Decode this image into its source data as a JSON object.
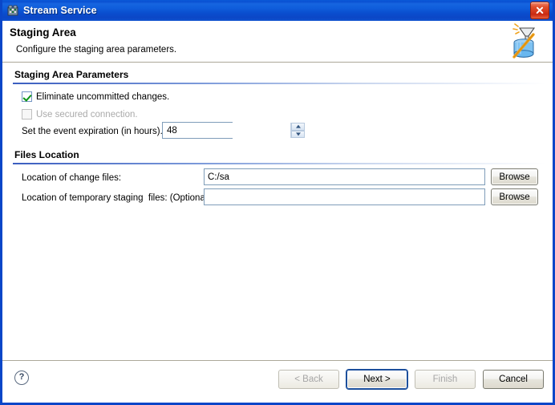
{
  "window": {
    "title": "Stream Service",
    "title_icon": "server-icon",
    "close_label": "close-icon"
  },
  "header": {
    "title": "Staging Area",
    "subtitle": "Configure the staging area parameters.",
    "banner_icon": "funnel-database-icon"
  },
  "sections": {
    "parameters": {
      "title": "Staging Area Parameters",
      "checkboxes": [
        {
          "label": "Eliminate uncommitted changes.",
          "checked": true,
          "disabled": false
        },
        {
          "label": "Use secured connection.",
          "checked": false,
          "disabled": true
        }
      ],
      "expiration": {
        "label": "Set the event expiration (in hours).",
        "value": "48"
      }
    },
    "files": {
      "title": "Files Location",
      "rows": [
        {
          "label": "Location of change files:",
          "value": "C:/sa",
          "placeholder": "",
          "browse_label": "Browse"
        },
        {
          "label": "Location of temporary staging  files: (Optional)",
          "value": "",
          "placeholder": "",
          "browse_label": "Browse"
        }
      ]
    }
  },
  "footer": {
    "help_label": "?",
    "buttons": [
      {
        "label": "< Back",
        "disabled": true,
        "focused": false
      },
      {
        "label": "Next >",
        "disabled": false,
        "focused": true
      },
      {
        "label": "Finish",
        "disabled": true,
        "focused": false
      },
      {
        "label": "Cancel",
        "disabled": false,
        "focused": false
      }
    ]
  },
  "colors": {
    "titlebar_blue": "#0a50d2",
    "window_border": "#0a46c8",
    "close_red": "#c92a12",
    "rule_blue": "#3b5ec0",
    "check_green": "#0b9415",
    "field_border": "#7f9db9"
  }
}
